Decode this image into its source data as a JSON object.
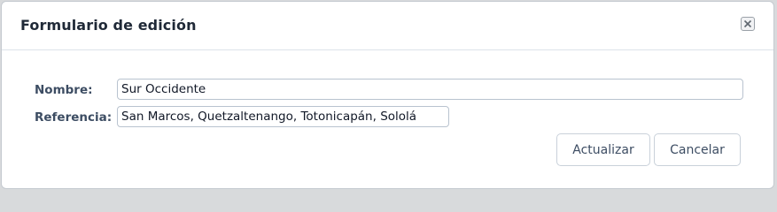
{
  "dialog": {
    "title": "Formulario de edición",
    "close_icon": "close-icon"
  },
  "form": {
    "nombre_label": "Nombre:",
    "nombre_value": "Sur Occidente",
    "referencia_label": "Referencia:",
    "referencia_value": "San Marcos, Quetzaltenango, Totonicapán, Sololá"
  },
  "buttons": {
    "update_label": "Actualizar",
    "cancel_label": "Cancelar"
  }
}
